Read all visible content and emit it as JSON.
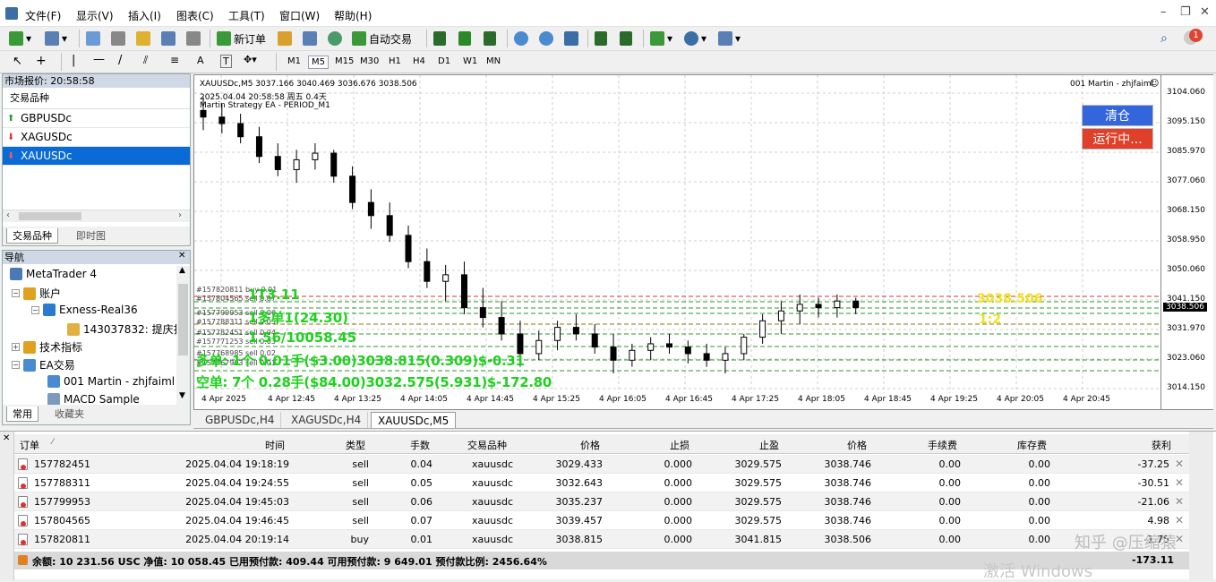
{
  "menu": {
    "items": [
      "文件(F)",
      "显示(V)",
      "插入(I)",
      "图表(C)",
      "工具(T)",
      "窗口(W)",
      "帮助(H)"
    ]
  },
  "toolbar": {
    "new_order": "新订单",
    "auto_trading": "自动交易",
    "notification_count": "1"
  },
  "timeframes": [
    "M1",
    "M5",
    "M15",
    "M30",
    "H1",
    "H4",
    "D1",
    "W1",
    "MN"
  ],
  "active_timeframe": "M5",
  "market_watch": {
    "title": "市场报价: 20:58:58",
    "column": "交易品种",
    "symbols": [
      "GBPUSDc",
      "XAGUSDc",
      "XAUUSDc"
    ],
    "selected": "XAUUSDc",
    "tabs": [
      "交易品种",
      "即时图"
    ]
  },
  "navigator": {
    "title": "导航",
    "root": "MetaTrader 4",
    "accounts": "账户",
    "server": "Exness-Real36",
    "account": "143037832: 提庆扫",
    "indicators": "技术指标",
    "ea": "EA交易",
    "ea_items": [
      "001 Martin - zhjfaiml",
      "MACD Sample"
    ],
    "tabs": [
      "常用",
      "收藏夹"
    ]
  },
  "chart": {
    "header": "XAUUSDc,M5  3037.166 3040.469 3036.676 3038.506",
    "ea_label": "001 Martin - zhjfaiml",
    "info_line": "2025.04.04 20:58:58 周五 0.4天",
    "strategy_line": "Martin Strategy EA  - PERIOD_M1",
    "btn_clear": "清仓",
    "btn_running": "运行中...",
    "current_price": "3038.506",
    "price_levels": [
      "3104.060",
      "3095.150",
      "3085.970",
      "3077.060",
      "3068.150",
      "3058.950",
      "3050.060",
      "3041.150",
      "3031.970",
      "3023.060",
      "3014.150"
    ],
    "time_labels": [
      "4 Apr 2025",
      "4 Apr 12:45",
      "4 Apr 13:25",
      "4 Apr 14:05",
      "4 Apr 14:45",
      "4 Apr 15:25",
      "4 Apr 16:05",
      "4 Apr 16:45",
      "4 Apr 17:25",
      "4 Apr 18:05",
      "4 Apr 18:45",
      "4 Apr 19:25",
      "4 Apr 20:05",
      "4 Apr 20:45"
    ],
    "overlay_lines": [
      "1T3.11",
      "1多单1(24.30)",
      "1.56/10058.45",
      "多单: 1个 0.01手($3.00)3038.815(0.309)$-0.31",
      "空单: 7个 0.28手($84.00)3032.575(5.931)$-172.80"
    ],
    "yellow_price": "3038.506",
    "yellow_ratio": "1:2",
    "order_labels": [
      "#157820811 buy 0.01",
      "#157804565 sell 0.07",
      "#157799953 sell 0.06",
      "#157788311 sell 0.05",
      "#157782451 sell 0.04",
      "#157771253 sell 0.03",
      "#157768985 sell 0.02",
      "#157767903 sell 0.01"
    ],
    "candles": [
      [
        3098,
        3102,
        3092,
        3096
      ],
      [
        3096,
        3100,
        3091,
        3094
      ],
      [
        3094,
        3097,
        3088,
        3090
      ],
      [
        3090,
        3093,
        3082,
        3084
      ],
      [
        3084,
        3088,
        3078,
        3080
      ],
      [
        3080,
        3086,
        3076,
        3083
      ],
      [
        3083,
        3088,
        3080,
        3085
      ],
      [
        3085,
        3086,
        3076,
        3078
      ],
      [
        3078,
        3081,
        3068,
        3070
      ],
      [
        3070,
        3074,
        3062,
        3066
      ],
      [
        3066,
        3070,
        3058,
        3060
      ],
      [
        3060,
        3063,
        3050,
        3052
      ],
      [
        3052,
        3056,
        3044,
        3046
      ],
      [
        3046,
        3051,
        3040,
        3048
      ],
      [
        3048,
        3052,
        3036,
        3038
      ],
      [
        3038,
        3044,
        3032,
        3035
      ],
      [
        3035,
        3040,
        3028,
        3030
      ],
      [
        3030,
        3034,
        3020,
        3024
      ],
      [
        3024,
        3031,
        3022,
        3028
      ],
      [
        3028,
        3034,
        3025,
        3032
      ],
      [
        3032,
        3036,
        3028,
        3030
      ],
      [
        3030,
        3033,
        3024,
        3026
      ],
      [
        3026,
        3030,
        3018,
        3022
      ],
      [
        3022,
        3027,
        3020,
        3025
      ],
      [
        3025,
        3029,
        3022,
        3027
      ],
      [
        3027,
        3030,
        3024,
        3026
      ],
      [
        3026,
        3028,
        3021,
        3024
      ],
      [
        3024,
        3027,
        3020,
        3022
      ],
      [
        3022,
        3026,
        3018,
        3024
      ],
      [
        3024,
        3030,
        3022,
        3029
      ],
      [
        3029,
        3036,
        3027,
        3034
      ],
      [
        3034,
        3040,
        3030,
        3037
      ],
      [
        3037,
        3042,
        3033,
        3039
      ],
      [
        3039,
        3041,
        3035,
        3038
      ],
      [
        3038,
        3042,
        3035,
        3040
      ],
      [
        3040,
        3041,
        3036,
        3038
      ]
    ]
  },
  "chart_tabs": [
    "GBPUSDc,H4",
    "XAGUSDc,H4",
    "XAUUSDc,M5"
  ],
  "active_chart_tab": "XAUUSDc,M5",
  "terminal": {
    "headers": [
      "订单",
      "时间",
      "类型",
      "手数",
      "交易品种",
      "价格",
      "止损",
      "止盈",
      "价格",
      "手续费",
      "库存费",
      "获利"
    ],
    "rows": [
      [
        "157782451",
        "2025.04.04 19:18:19",
        "sell",
        "0.04",
        "xauusdc",
        "3029.433",
        "0.000",
        "3029.575",
        "3038.746",
        "0.00",
        "0.00",
        "-37.25"
      ],
      [
        "157788311",
        "2025.04.04 19:24:55",
        "sell",
        "0.05",
        "xauusdc",
        "3032.643",
        "0.000",
        "3029.575",
        "3038.746",
        "0.00",
        "0.00",
        "-30.51"
      ],
      [
        "157799953",
        "2025.04.04 19:45:03",
        "sell",
        "0.06",
        "xauusdc",
        "3035.237",
        "0.000",
        "3029.575",
        "3038.746",
        "0.00",
        "0.00",
        "-21.06"
      ],
      [
        "157804565",
        "2025.04.04 19:46:45",
        "sell",
        "0.07",
        "xauusdc",
        "3039.457",
        "0.000",
        "3029.575",
        "3038.746",
        "0.00",
        "0.00",
        "4.98"
      ],
      [
        "157820811",
        "2025.04.04 20:19:14",
        "buy",
        "0.01",
        "xauusdc",
        "3038.815",
        "0.000",
        "3041.815",
        "3038.506",
        "0.00",
        "0.00",
        "-1.75"
      ]
    ],
    "summary": "余额: 10 231.56 USC  净值: 10 058.45  已用预付款: 409.44  可用预付款: 9 649.01  预付款比例: 2456.64%",
    "total": "-173.11"
  },
  "watermark": {
    "brand": "知乎 @压缩猿",
    "activate": "激活 Windows"
  }
}
